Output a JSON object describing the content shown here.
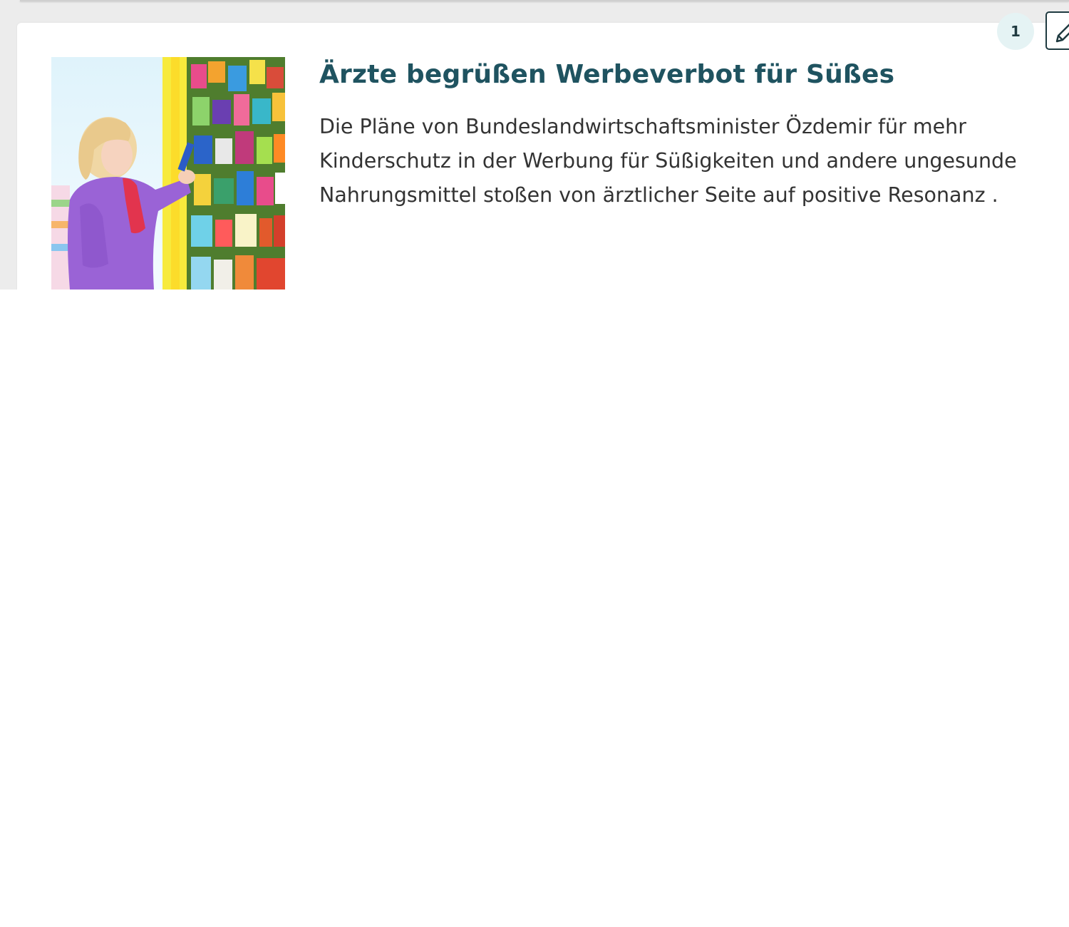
{
  "article": {
    "title": "Ärzte begrüßen Werbeverbot für Süßes",
    "teaser": "Die Pläne von Bundeslandwirtschaftsminister Özdemir für mehr Kinderschutz in der Werbung für Süßigkeiten und andere ungesunde Nahrungsmittel stoßen von ärztlicher Seite auf positive Resonanz .",
    "badge_count": "1",
    "image_icon": "photo-child-candy-shelf",
    "edit_icon": "pencil-icon"
  },
  "colors": {
    "title": "#1f5360",
    "text": "#333333",
    "badge_bg": "#e5f3f4",
    "page_bg": "#ececec"
  }
}
